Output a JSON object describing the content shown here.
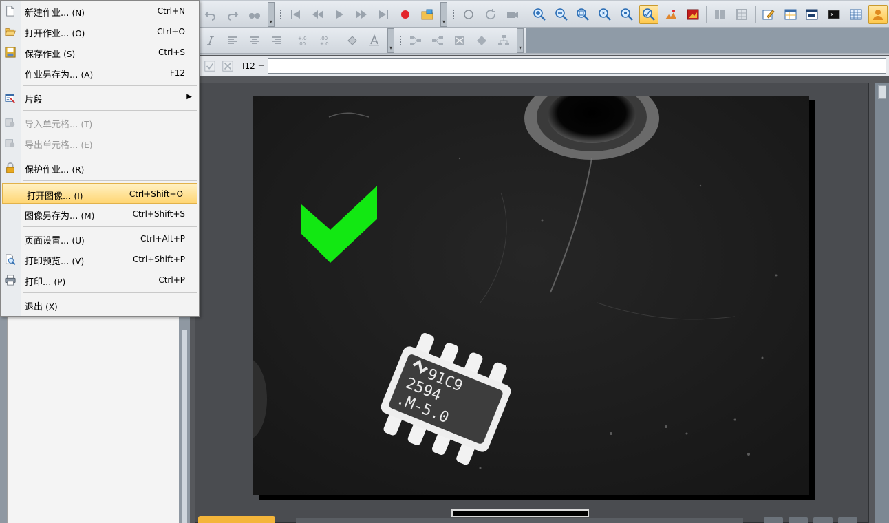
{
  "menu": {
    "items": [
      {
        "label": "新建作业...",
        "key": "(N)",
        "shortcut": "Ctrl+N",
        "icon": "new-file-icon"
      },
      {
        "label": "打开作业...",
        "key": "(O)",
        "shortcut": "Ctrl+O",
        "icon": "open-folder-icon"
      },
      {
        "label": "保存作业",
        "key": "(S)",
        "shortcut": "Ctrl+S",
        "icon": "save-disk-icon"
      },
      {
        "label": "作业另存为...",
        "key": "(A)",
        "shortcut": "F12",
        "icon": ""
      },
      {
        "label": "片段",
        "key": "",
        "shortcut": "",
        "icon": "snippet-icon",
        "submenu": true
      },
      {
        "label": "导入单元格...",
        "key": "(T)",
        "shortcut": "",
        "icon": "import-cells-icon",
        "disabled": true
      },
      {
        "label": "导出单元格...",
        "key": "(E)",
        "shortcut": "",
        "icon": "export-cells-icon",
        "disabled": true
      },
      {
        "label": "保护作业...",
        "key": "(R)",
        "shortcut": "",
        "icon": "lock-icon"
      },
      {
        "label": "打开图像...",
        "key": "(I)",
        "shortcut": "Ctrl+Shift+O",
        "icon": "",
        "highlighted": true
      },
      {
        "label": "图像另存为...",
        "key": "(M)",
        "shortcut": "Ctrl+Shift+S",
        "icon": ""
      },
      {
        "label": "页面设置...",
        "key": "(U)",
        "shortcut": "Ctrl+Alt+P",
        "icon": ""
      },
      {
        "label": "打印预览...",
        "key": "(V)",
        "shortcut": "Ctrl+Shift+P",
        "icon": "print-preview-icon"
      },
      {
        "label": "打印...",
        "key": "(P)",
        "shortcut": "Ctrl+P",
        "icon": "printer-icon"
      },
      {
        "label": "退出",
        "key": "(X)",
        "shortcut": "",
        "icon": ""
      }
    ]
  },
  "formula_bar": {
    "cell_ref": "I12 ="
  },
  "image": {
    "chip_marking": [
      "91C9",
      "2594",
      ".M-5.0"
    ],
    "check_color": "#12e812"
  },
  "toolbar": {
    "accent": "#ffc84a"
  }
}
